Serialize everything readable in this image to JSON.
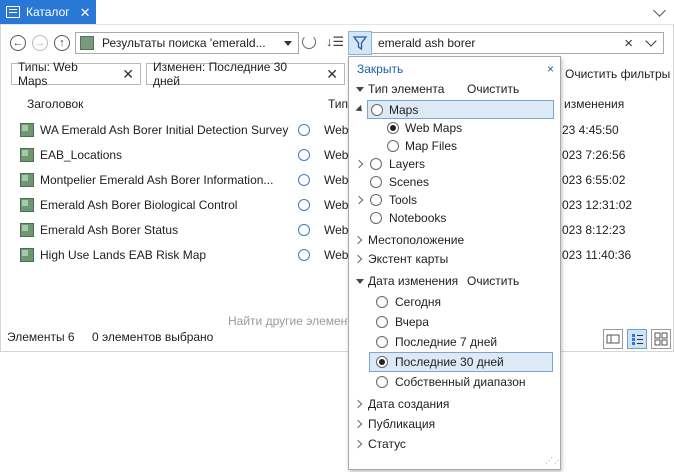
{
  "tab": {
    "label": "Каталог"
  },
  "toolbar": {
    "path_text": "Результаты поиска 'emerald...",
    "search_value": "emerald ash borer"
  },
  "chips": [
    {
      "label": "Типы: Web Maps"
    },
    {
      "label": "Изменен: Последние 30 дней"
    }
  ],
  "clear_filters": "Очистить фильтры",
  "columns": {
    "title": "Заголовок",
    "type": "Тип",
    "modified": "изменения"
  },
  "rows": [
    {
      "title": "WA Emerald Ash Borer Initial Detection Survey",
      "type": "Web",
      "date": "23 4:45:50"
    },
    {
      "title": "EAB_Locations",
      "type": "Web",
      "date": "023 7:26:56"
    },
    {
      "title": "Montpelier Emerald Ash Borer Information...",
      "type": "Web",
      "date": "023 6:55:02"
    },
    {
      "title": "Emerald Ash Borer Biological Control",
      "type": "Web",
      "date": "023 12:31:02"
    },
    {
      "title": "Emerald Ash Borer Status",
      "type": "Web",
      "date": "023 8:12:23"
    },
    {
      "title": "High Use Lands EAB Risk Map",
      "type": "Web",
      "date": "023 11:40:36"
    }
  ],
  "find_more": "Найти другие элемент",
  "status": {
    "count": "Элементы 6",
    "selected": "0 элементов выбрано"
  },
  "filter_panel": {
    "close": "Закрыть",
    "close_x": "×",
    "type_section": "Тип элемента",
    "clear": "Очистить",
    "maps": "Maps",
    "web_maps": "Web Maps",
    "map_files": "Map Files",
    "layers": "Layers",
    "scenes": "Scenes",
    "tools": "Tools",
    "notebooks": "Notebooks",
    "location": "Местоположение",
    "map_extent": "Экстент карты",
    "date_modified": "Дата изменения",
    "date_clear": "Очистить",
    "today": "Сегодня",
    "yesterday": "Вчера",
    "last7": "Последние 7 дней",
    "last30": "Последние 30 дней",
    "custom": "Собственный диапазон",
    "date_created": "Дата создания",
    "publishing": "Публикация",
    "status": "Статус"
  },
  "colors": {
    "accent": "#2a78d5",
    "highlight": "#dde9f5"
  }
}
